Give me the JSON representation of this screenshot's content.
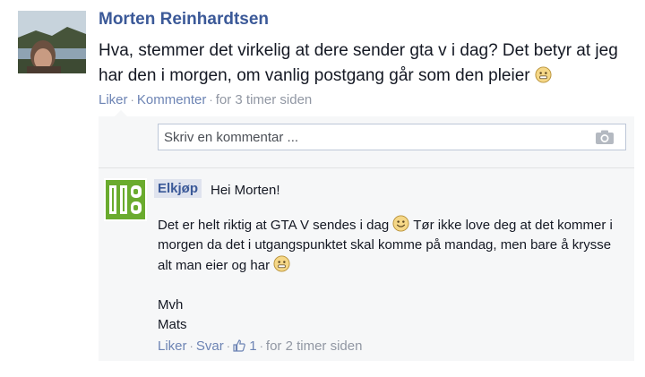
{
  "post": {
    "author": "Morten Reinhardtsen",
    "text_before": "Hva, stemmer det virkelig at dere sender gta v i dag? Det betyr at jeg har den i morgen, om vanlig postgang går som den pleier",
    "like_label": "Liker",
    "comment_label": "Kommenter",
    "timestamp": "for 3 timer siden",
    "emoji_icon": "smiley-emoticon-icon"
  },
  "comment_input": {
    "placeholder": "Skriv en kommentar ...",
    "icon": "camera-icon"
  },
  "comment": {
    "author": "Elkjøp",
    "first_line": "Hei Morten!",
    "body_part1": "Det er helt riktig at GTA V sendes i dag",
    "body_part2": "Tør ikke love deg at det kommer i morgen da det i utgangspunktet skal komme på mandag, men bare å krysse alt man eier og har",
    "sign_line1": "Mvh",
    "sign_line2": "Mats",
    "like_label": "Liker",
    "reply_label": "Svar",
    "like_count": "1",
    "timestamp": "for 2 timer siden"
  },
  "colors": {
    "link": "#3b5998",
    "muted": "#9197a3",
    "comment_bg": "#f6f7f8",
    "brand_green": "#6aab2e"
  }
}
